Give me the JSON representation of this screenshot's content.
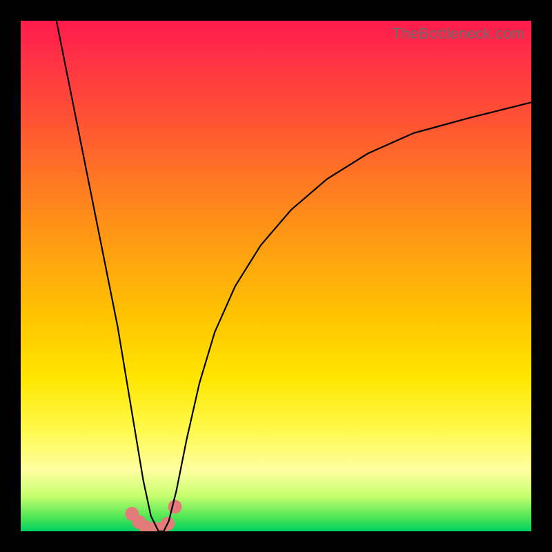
{
  "watermark": "TheBottleneck.com",
  "chart_data": {
    "type": "line",
    "title": "",
    "xlabel": "",
    "ylabel": "",
    "xlim": [
      0,
      100
    ],
    "ylim": [
      0,
      100
    ],
    "background_gradient": [
      "#ff1a4d",
      "#ffa010",
      "#fff94a",
      "#00d060"
    ],
    "series": [
      {
        "name": "curve",
        "color": "#000000",
        "x": [
          7,
          9,
          11,
          13,
          15,
          17,
          19,
          21,
          22.5,
          24,
          25.5,
          27,
          28,
          29,
          30.5,
          32.5,
          35,
          38,
          42,
          47,
          53,
          60,
          68,
          77,
          88,
          100
        ],
        "y": [
          100,
          90,
          80,
          70,
          60,
          50,
          40,
          28,
          19,
          10,
          3,
          0,
          0,
          2,
          8,
          18,
          29,
          39,
          48,
          56,
          63,
          69,
          74,
          78,
          81,
          84
        ]
      }
    ],
    "points": [
      {
        "x": 21.8,
        "y": 3.4
      },
      {
        "x": 23.2,
        "y": 1.8
      },
      {
        "x": 24.5,
        "y": 0.8
      },
      {
        "x": 26.2,
        "y": 0.5
      },
      {
        "x": 27.6,
        "y": 0.5
      },
      {
        "x": 28.8,
        "y": 1.5
      },
      {
        "x": 30.2,
        "y": 4.8
      }
    ],
    "point_color": "#e47b7b",
    "point_radius": 10
  }
}
